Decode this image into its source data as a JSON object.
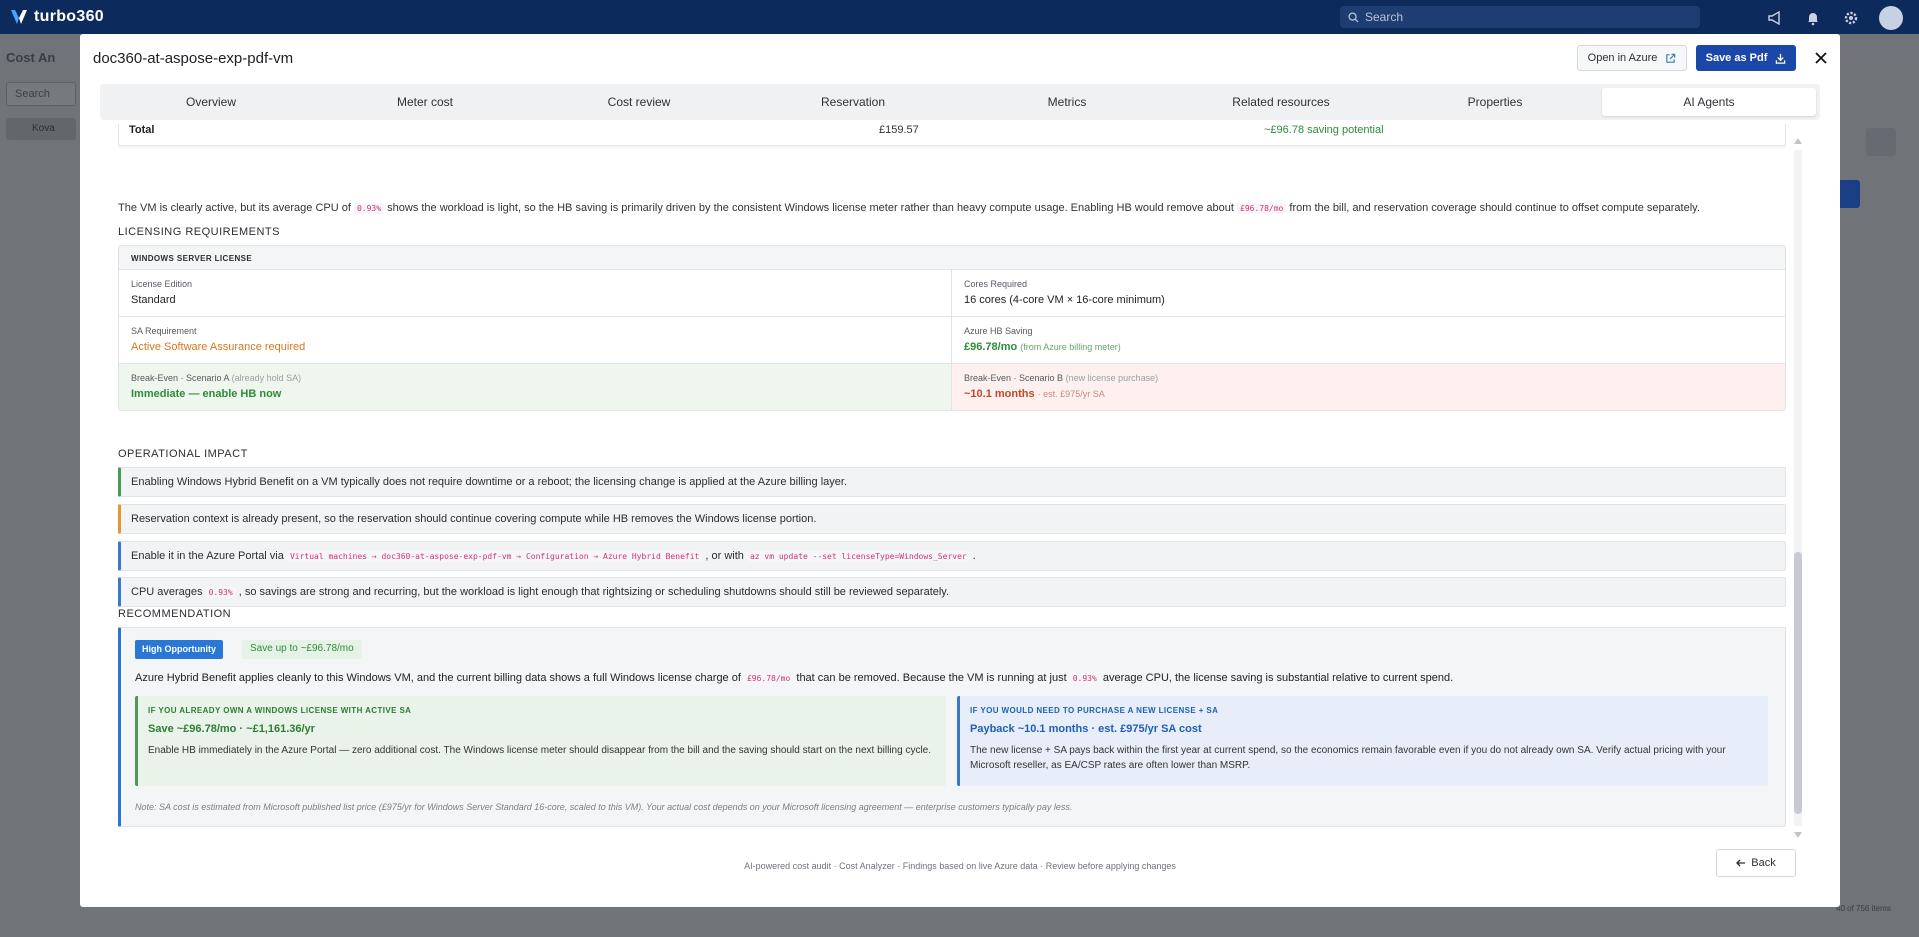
{
  "app": {
    "brand": "turbo360",
    "search_placeholder": "Search"
  },
  "background": {
    "crumb": "Cost An",
    "search_placeholder": "Search",
    "row_label": "Kova",
    "pager": "40 of 756 items"
  },
  "modal": {
    "title": "doc360-at-aspose-exp-pdf-vm",
    "open_azure_label": "Open in Azure",
    "save_pdf_label": "Save as Pdf",
    "tabs": [
      "Overview",
      "Meter cost",
      "Cost review",
      "Reservation",
      "Metrics",
      "Related resources",
      "Properties",
      "AI Agents"
    ],
    "active_tab": "AI Agents",
    "footer": "AI-powered cost audit · Cost Analyzer · Findings based on live Azure data · Review before applying changes",
    "back_label": "Back"
  },
  "total_row": {
    "label": "Total",
    "amount": "£159.57",
    "potential": "~£96.78 saving potential"
  },
  "summary": {
    "p1": "The VM is clearly active, but its average CPU of ",
    "cpu": "0.93%",
    "p2": " shows the workload is light, so the HB saving is primarily driven by the consistent Windows license meter rather than heavy compute usage. Enabling HB would remove about ",
    "amount": "£96.78/mo",
    "p3": " from the bill, and reservation coverage should continue to offset compute separately."
  },
  "licensing": {
    "heading": "LICENSING REQUIREMENTS",
    "box_title": "WINDOWS SERVER LICENSE",
    "license_edition_label": "License Edition",
    "license_edition": "Standard",
    "cores_label": "Cores Required",
    "cores": "16 cores (4-core VM × 16-core minimum)",
    "sa_label": "SA Requirement",
    "sa": "Active Software Assurance required",
    "hb_label": "Azure HB Saving",
    "hb": "£96.78/mo",
    "hb_sub": "(from Azure billing meter)",
    "be_a_label": "Break-Even · Scenario A",
    "be_a_muted": "(already hold SA)",
    "be_a": "Immediate — enable HB now",
    "be_b_label": "Break-Even · Scenario B",
    "be_b_muted": "(new license purchase)",
    "be_b": "~10.1 months",
    "be_b_sub": "· est. £975/yr SA"
  },
  "operational": {
    "heading": "OPERATIONAL IMPACT",
    "i1": "Enabling Windows Hybrid Benefit on a VM typically does not require downtime or a reboot; the licensing change is applied at the Azure billing layer.",
    "i2": "Reservation context is already present, so the reservation should continue covering compute while HB removes the Windows license portion.",
    "i3a": "Enable it in the Azure Portal via ",
    "i3path": "Virtual machines → doc360-at-aspose-exp-pdf-vm → Configuration → Azure Hybrid Benefit",
    "i3b": " , or with ",
    "i3cmd": "az vm update --set licenseType=Windows_Server",
    "i3c": " .",
    "i4a": "CPU averages ",
    "i4cpu": "0.93%",
    "i4b": " , so savings are strong and recurring, but the workload is light enough that rightsizing or scheduling shutdowns should still be reviewed separately."
  },
  "recommendation": {
    "heading": "RECOMMENDATION",
    "badge": "High Opportunity",
    "save_badge": "Save up to ~£96.78/mo",
    "t1": "Azure Hybrid Benefit applies cleanly to this Windows VM, and the current billing data shows a full Windows license charge of ",
    "amount": "£96.78/mo",
    "t2": " that can be removed. Because the VM is running at just ",
    "cpu": "0.93%",
    "t3": " average CPU, the license saving is substantial relative to current spend.",
    "opt_a_title": "IF YOU ALREADY OWN A WINDOWS LICENSE WITH ACTIVE SA",
    "opt_a_head": "Save ~£96.78/mo · ~£1,161.36/yr",
    "opt_a_desc": "Enable HB immediately in the Azure Portal — zero additional cost. The Windows license meter should disappear from the bill and the saving should start on the next billing cycle.",
    "opt_b_title": "IF YOU WOULD NEED TO PURCHASE A NEW LICENSE + SA",
    "opt_b_head": "Payback ~10.1 months · est. £975/yr SA cost",
    "opt_b_desc": "The new license + SA pays back within the first year at current spend, so the economics remain favorable even if you do not already own SA. Verify actual pricing with your Microsoft reseller, as EA/CSP rates are often lower than MSRP.",
    "note": "Note: SA cost is estimated from Microsoft published list price (£975/yr for Windows Server Standard 16-core, scaled to this VM). Your actual cost depends on your Microsoft licensing agreement — enterprise customers typically pay less."
  }
}
